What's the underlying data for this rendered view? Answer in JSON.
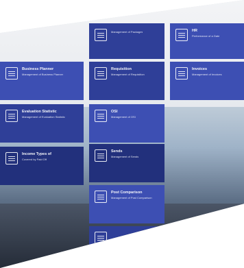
{
  "tiles": [
    {
      "id": "t1",
      "title": "",
      "subtitle": "Management of Packages"
    },
    {
      "id": "t2",
      "title": "HR",
      "subtitle": "Performance of a Gate"
    },
    {
      "id": "t3",
      "title": "Business Planner",
      "subtitle": "Management of Business Planner"
    },
    {
      "id": "t4",
      "title": "Requisition",
      "subtitle": "Management of Requisition"
    },
    {
      "id": "t5",
      "title": "Invoices",
      "subtitle": "Management of Invoices"
    },
    {
      "id": "t6",
      "title": "Evaluation Statistic",
      "subtitle": "Management of Evaluation Statistic"
    },
    {
      "id": "t7",
      "title": "OSI",
      "subtitle": "Management of OSI"
    },
    {
      "id": "t8",
      "title": "Income Types of",
      "subtitle": "Covered by Paid Off"
    },
    {
      "id": "t9",
      "title": "Sends",
      "subtitle": "Management of Sends"
    },
    {
      "id": "t10",
      "title": "Post Comparison",
      "subtitle": "Management of Post Comparison"
    },
    {
      "id": "t11",
      "title": "",
      "subtitle": ""
    }
  ]
}
